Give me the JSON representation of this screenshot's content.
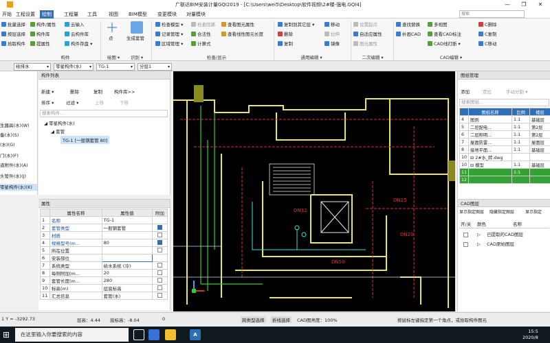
{
  "window": {
    "title": "广联达BIM安装计量GQI2019 - [C:\\Users\\wei5\\Desktop\\软件视频\\2#楼-强电.GQI4]",
    "controls": [
      "—",
      "❐",
      "✕"
    ]
  },
  "menu": {
    "tabs": [
      "开始",
      "工程设置",
      "绘制",
      "工程量",
      "工具",
      "视图",
      "BIM模型",
      "变更模块",
      "对量模块"
    ],
    "active_index": 2,
    "search_placeholder": "搜索"
  },
  "ribbon": {
    "col1": [
      "批量选择",
      "按层选择",
      "拾取构件"
    ],
    "col2": [
      "构件/属性",
      "构件库",
      "提属性"
    ],
    "col3": [
      "云输入",
      "云构件库",
      "构件存盘 ▾"
    ],
    "group1_label": "构件",
    "point_label": "点",
    "gen_label": "生成套管",
    "group2a_label": "绘图 ▾",
    "group2b_label": "识别 ▾",
    "check1": [
      "检查模型 ▾",
      "记录管理 ▾",
      "区域管理 ▾"
    ],
    "check2": [
      "检查回路",
      "合法性",
      "计算式"
    ],
    "check3": [
      "查看图元属性",
      "查看线性图元长度"
    ],
    "group3_label": "检查/显示",
    "edit1": [
      "复制到其它层 ▾",
      "删除",
      "复制"
    ],
    "edit2": [
      "移动",
      "拉伸",
      "镜像"
    ],
    "group4_label": "通用编辑 ▾",
    "edit3": [
      "设置起点",
      "自适应属性",
      "图元属性"
    ],
    "group5_label": "二次编辑 ▾",
    "cad1": [
      "查找替换",
      "补画CAD",
      "CAD线打断 ▾"
    ],
    "cad2": [
      "多视图",
      "查看CAD标注",
      "CAD线打断 ▾"
    ],
    "cad3": [
      "C删除",
      "C复制",
      "C移动"
    ],
    "group6_label": "CAD编辑 ▾"
  },
  "selectors": [
    "给排水",
    "零星构件(水)",
    "TG-1",
    "分层1"
  ],
  "leftnav": {
    "items": [
      "生器具(水)(W)",
      "备(水)(S)",
      "(水)(G)",
      "门(水)(F)",
      "道附件(水)(A)",
      "头管件(水)(J)",
      "零星构件(水)(K)"
    ],
    "selected_index": 6
  },
  "component_list": {
    "title": "构件列表",
    "toolbar1": [
      "新建 ▾",
      "删除",
      "复制",
      "构件库>>"
    ],
    "toolbar2": [
      "排序 ▾",
      "过滤 ▾",
      "上移",
      "下移"
    ],
    "search_placeholder": "搜索构件...",
    "tree": [
      "零星构件(水)",
      "套管",
      "TG-1 [一般钢套管 80]"
    ]
  },
  "properties": {
    "title": "属性",
    "headers": [
      "属性名称",
      "属性值",
      "附加"
    ],
    "rows": [
      {
        "num": "1",
        "name": "名称",
        "value": "TG-1",
        "check": "none"
      },
      {
        "num": "2",
        "name": "套管类型",
        "value": "一般钢套管",
        "check": "on"
      },
      {
        "num": "3",
        "name": "材质",
        "value": "",
        "check": "off"
      },
      {
        "num": "4",
        "name": "规格型号(m...",
        "value": "80",
        "check": "on"
      },
      {
        "num": "5",
        "name": "所在位置",
        "value": "",
        "check": "off"
      },
      {
        "num": "6",
        "name": "安装部位",
        "value": "",
        "check": "dropdown"
      },
      {
        "num": "7",
        "name": "系统类型",
        "value": "给水系统 (冷)",
        "check": "off"
      },
      {
        "num": "8",
        "name": "每侧附加(m...",
        "value": "20",
        "check": "off"
      },
      {
        "num": "9",
        "name": "套管长度(m...",
        "value": "280",
        "check": "off"
      },
      {
        "num": "10",
        "name": "标高(m)",
        "value": "层底标高",
        "check": "off"
      },
      {
        "num": "11",
        "name": "汇总信息",
        "value": "套管(水)",
        "check": "off"
      }
    ]
  },
  "drawing": {
    "labels": [
      "DN32",
      "DN25",
      "DN20",
      "DN50"
    ]
  },
  "right_panel": {
    "title": "图纸管理",
    "toolbar": [
      "添加",
      "定位",
      "手动分割 ▾"
    ],
    "search_placeholder": "搜索图纸...",
    "headers": [
      "",
      "图纸名称",
      "比例",
      "楼层"
    ],
    "rows": [
      {
        "num": "4",
        "name": "图例",
        "scale": "1:1",
        "floor": "基础层",
        "green": false
      },
      {
        "num": "5",
        "name": "二层配电...",
        "scale": "1:1",
        "floor": "第2层",
        "green": false
      },
      {
        "num": "6",
        "name": "二层照明...",
        "scale": "1:1",
        "floor": "第2层",
        "green": false
      },
      {
        "num": "7",
        "name": "屋面防雷...",
        "scale": "1:1",
        "floor": "屋面层",
        "green": false
      },
      {
        "num": "8",
        "name": "接地平面...",
        "scale": "1:1",
        "floor": "基础层",
        "green": false
      },
      {
        "num": "10",
        "name": "⊟ 2#水_转.dwg",
        "scale": "",
        "floor": "",
        "green": false
      },
      {
        "num": "10",
        "name": "⊟ 模型",
        "scale": "1:1",
        "floor": "基础层",
        "green": false
      },
      {
        "num": "11",
        "name": "",
        "scale": "1:1",
        "floor": "",
        "green": true
      },
      {
        "num": "12",
        "name": "",
        "scale": "",
        "floor": "",
        "green": true
      }
    ],
    "cad_layers_title": "CAD图层",
    "layer_toolbar": [
      "显示指定图层",
      "隐藏指定图层",
      "显示指定"
    ],
    "layer_headers": [
      "开/关",
      "颜色",
      "名称"
    ],
    "layers": [
      "已提取的CAD图层",
      "CAD原始图层"
    ]
  },
  "status": {
    "coords": "1 Y = -3292.73",
    "floor_height": "层高：4.44",
    "base_height": "底标高：-8.04",
    "zero": "0",
    "cross_layer": "跨类型选择",
    "polyline": "折线选择",
    "cad_brightness": "CAD图亮度：100%",
    "hint": "按鼠标左键指定第一个角点，或拾取构件图元"
  },
  "taskbar": {
    "search_text": "在这里输入你要搜索的内容",
    "time": "15:5",
    "date": "2020/8"
  }
}
